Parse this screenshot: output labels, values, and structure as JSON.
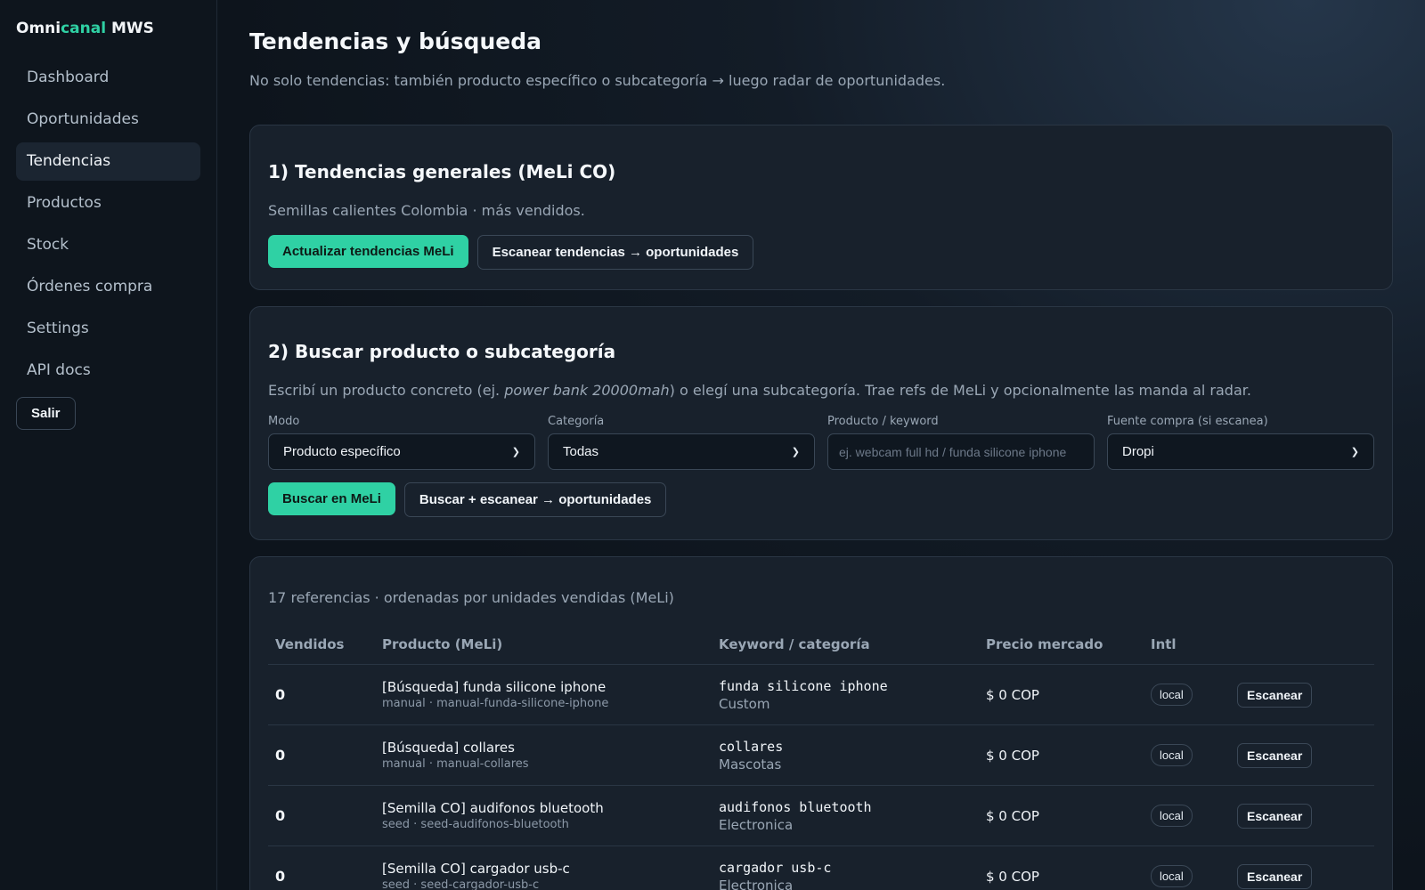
{
  "brand": {
    "part1": "Omni",
    "part2": "canal",
    "part3": " MWS"
  },
  "sidebar": {
    "items": [
      {
        "label": "Dashboard"
      },
      {
        "label": "Oportunidades"
      },
      {
        "label": "Tendencias",
        "active": true
      },
      {
        "label": "Productos"
      },
      {
        "label": "Stock"
      },
      {
        "label": "Órdenes compra"
      },
      {
        "label": "Settings"
      },
      {
        "label": "API docs"
      }
    ],
    "logout_label": "Salir"
  },
  "page": {
    "title": "Tendencias y búsqueda",
    "subtitle": "No solo tendencias: también producto específico o subcategoría → luego radar de oportunidades."
  },
  "section1": {
    "title": "1) Tendencias generales (MeLi CO)",
    "desc": "Semillas calientes Colombia · más vendidos.",
    "btn_primary": "Actualizar tendencias MeLi",
    "btn_secondary": "Escanear tendencias → oportunidades"
  },
  "section2": {
    "title": "2) Buscar producto o subcategoría",
    "desc_pre": "Escribí un producto concreto (ej. ",
    "desc_em": "power bank 20000mah",
    "desc_post": ") o elegí una subcategoría. Trae refs de MeLi y opcionalmente las manda al radar.",
    "modo_label": "Modo",
    "modo_value": "Producto específico",
    "categoria_label": "Categoría",
    "categoria_value": "Todas",
    "keyword_label": "Producto / keyword",
    "keyword_placeholder": "ej. webcam full hd / funda silicone iphone",
    "fuente_label": "Fuente compra (si escanea)",
    "fuente_value": "Dropi",
    "btn_primary": "Buscar en MeLi",
    "btn_secondary": "Buscar + escanear → oportunidades"
  },
  "results": {
    "count_text": "17 referencias · ordenadas por unidades vendidas (MeLi)",
    "columns": [
      "Vendidos",
      "Producto (MeLi)",
      "Keyword / categoría",
      "Precio mercado",
      "Intl",
      ""
    ],
    "scan_label": "Escanear",
    "rows": [
      {
        "sold": "0",
        "title": "[Búsqueda] funda silicone iphone",
        "sub": "manual · manual-funda-silicone-iphone",
        "keyword": "funda silicone iphone",
        "category": "Custom",
        "price": "$ 0 COP",
        "intl": "local"
      },
      {
        "sold": "0",
        "title": "[Búsqueda] collares",
        "sub": "manual · manual-collares",
        "keyword": "collares",
        "category": "Mascotas",
        "price": "$ 0 COP",
        "intl": "local"
      },
      {
        "sold": "0",
        "title": "[Semilla CO] audifonos bluetooth",
        "sub": "seed · seed-audifonos-bluetooth",
        "keyword": "audifonos bluetooth",
        "category": "Electronica",
        "price": "$ 0 COP",
        "intl": "local"
      },
      {
        "sold": "0",
        "title": "[Semilla CO] cargador usb-c",
        "sub": "seed · seed-cargador-usb-c",
        "keyword": "cargador usb-c",
        "category": "Electronica",
        "price": "$ 0 COP",
        "intl": "local"
      }
    ]
  }
}
